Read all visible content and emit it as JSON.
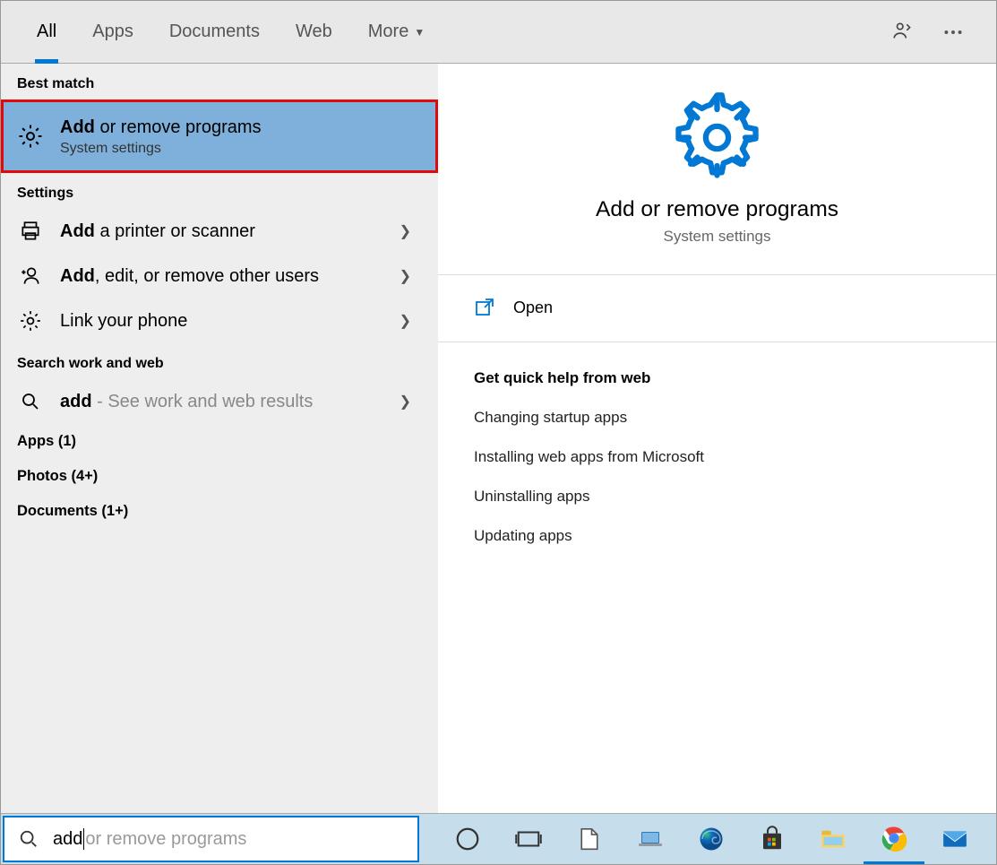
{
  "tabs": {
    "all": "All",
    "apps": "Apps",
    "documents": "Documents",
    "web": "Web",
    "more": "More"
  },
  "left": {
    "bestMatch": "Best match",
    "bm": {
      "bold": "Add",
      "rest": " or remove programs",
      "sub": "System settings"
    },
    "settings": "Settings",
    "s1": {
      "bold": "Add",
      "rest": " a printer or scanner"
    },
    "s2": {
      "bold": "Add",
      "rest": ", edit, or remove other users"
    },
    "s3": {
      "text": "Link your phone"
    },
    "work": "Search work and web",
    "w1": {
      "bold": "add",
      "rest": " - See work and web results"
    },
    "apps": "Apps (1)",
    "photos": "Photos (4+)",
    "docs": "Documents (1+)"
  },
  "detail": {
    "title": "Add or remove programs",
    "subtitle": "System settings",
    "open": "Open",
    "qhHeader": "Get quick help from web",
    "qh1": "Changing startup apps",
    "qh2": "Installing web apps from Microsoft",
    "qh3": "Uninstalling apps",
    "qh4": "Updating apps"
  },
  "search": {
    "typed": "add",
    "completion": " or remove programs"
  }
}
